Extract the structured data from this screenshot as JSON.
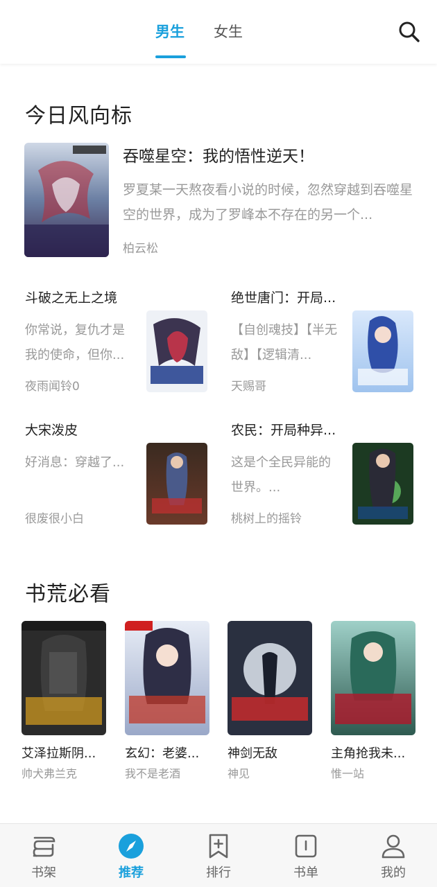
{
  "header": {
    "tabs": [
      {
        "label": "男生",
        "active": true
      },
      {
        "label": "女生",
        "active": false
      }
    ],
    "search_icon": "search-icon",
    "accent_color": "#1aa0dc"
  },
  "trend": {
    "title": "今日风向标",
    "featured": {
      "title": "吞噬星空：我的悟性逆天！",
      "desc": "罗夏某一天熬夜看小说的时候，忽然穿越到吞噬星空的世界，成为了罗峰本不存在的另一个...",
      "author": "柏云松"
    },
    "items": [
      {
        "title": "斗破之无上之境",
        "desc": "你常说，复仇才是我的使命，但你...",
        "author": "夜雨闻铃0"
      },
      {
        "title": "绝世唐门：开局...",
        "desc": "【自创魂技】【半无敌】【逻辑清...",
        "author": "天赐哥"
      },
      {
        "title": "大宋泼皮",
        "desc": "好消息：穿越了...",
        "author": "很废很小白"
      },
      {
        "title": "农民：开局种异...",
        "desc": "这是个全民异能的世界。...",
        "author": "桃树上的摇铃"
      }
    ]
  },
  "must_read": {
    "title": "书荒必看",
    "books": [
      {
        "title": "艾泽拉斯阴...",
        "author": "帅犬弗兰克"
      },
      {
        "title": "玄幻：老婆...",
        "author": "我不是老酒"
      },
      {
        "title": "神剑无敌",
        "author": "神见"
      },
      {
        "title": "主角抢我未...",
        "author": "惟一站"
      }
    ]
  },
  "bottom_nav": [
    {
      "label": "书架",
      "icon": "bookshelf-icon",
      "active": false
    },
    {
      "label": "推荐",
      "icon": "compass-icon",
      "active": true
    },
    {
      "label": "排行",
      "icon": "ranking-bookmark-icon",
      "active": false
    },
    {
      "label": "书单",
      "icon": "booklist-icon",
      "active": false
    },
    {
      "label": "我的",
      "icon": "profile-icon",
      "active": false
    }
  ]
}
